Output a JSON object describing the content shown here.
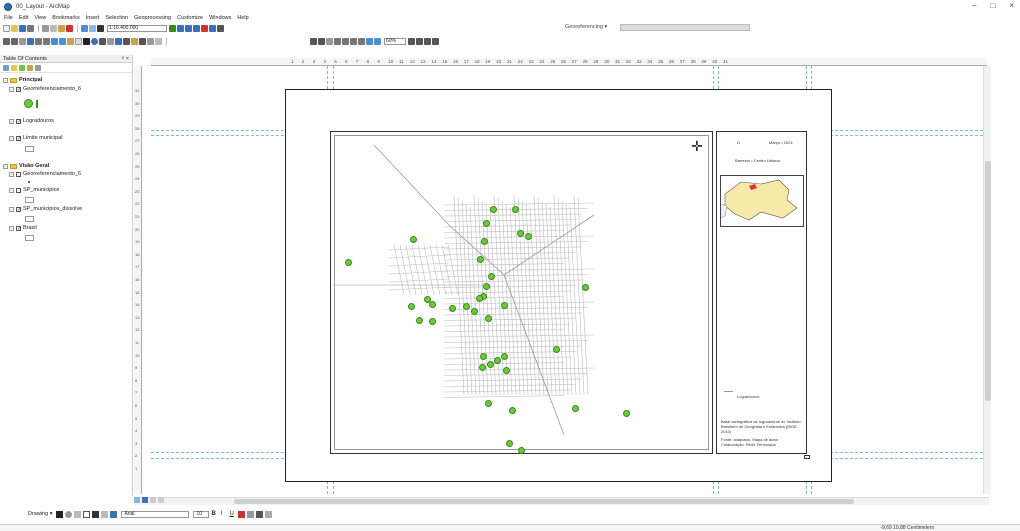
{
  "window": {
    "title": "00_Layout - ArcMap",
    "controls": [
      "–",
      "□",
      "×"
    ]
  },
  "menu": [
    "File",
    "Edit",
    "View",
    "Bookmarks",
    "Insert",
    "Selection",
    "Geoprocessing",
    "Customize",
    "Windows",
    "Help"
  ],
  "toolbar": {
    "scale": "1:16.400.000",
    "zoom_percent": "60%",
    "georeferencing_label": "Georeferencing ▾"
  },
  "toc": {
    "title": "Table Of Contents",
    "groups": [
      {
        "name": "Principal",
        "layers": [
          "Georreferenciamento_6",
          "Logradouros",
          "Limite municipal"
        ]
      },
      {
        "name": "Visão Geral",
        "layers": [
          "Georreferenciamento_6",
          "SP_municipios",
          "SP_municipios_dissolve",
          "Brasil"
        ]
      }
    ]
  },
  "ruler_top_labels": [
    "1",
    "2",
    "3",
    "4",
    "5",
    "6",
    "7",
    "8",
    "9",
    "10",
    "11",
    "12",
    "13",
    "14",
    "15",
    "16",
    "17",
    "18",
    "19",
    "20",
    "21",
    "22",
    "23",
    "24",
    "25",
    "26",
    "27",
    "28",
    "29",
    "30",
    "31",
    "32",
    "33",
    "34",
    "35",
    "36",
    "37",
    "38",
    "39",
    "40",
    "41"
  ],
  "ruler_left_labels": [
    "31",
    "30",
    "29",
    "28",
    "27",
    "26",
    "25",
    "24",
    "23",
    "22",
    "21",
    "20",
    "19",
    "18",
    "17",
    "16",
    "15",
    "14",
    "13",
    "12",
    "11",
    "10",
    "9",
    "8",
    "7",
    "6",
    "5",
    "4",
    "3",
    "2",
    "1"
  ],
  "map_side_panel": {
    "header_left": "Ω",
    "header_right": "Março • 2024",
    "subtitle": "Barretos • Centro Urbano",
    "legend_label": "Logradouros",
    "source_text": "Base cartográfica de logradouros do Instituto Brasileiro de Geografia e Estatística (IBGE, 2010)",
    "author_text": "Fonte: adaptado. Mapa de autor Colaboração. Rede Ferroviária"
  },
  "drawing_bar": {
    "label": "Drawing ▾",
    "font": "Arial",
    "size": "10"
  },
  "status": {
    "coords": "-9,69  10,88 Centimeters"
  }
}
